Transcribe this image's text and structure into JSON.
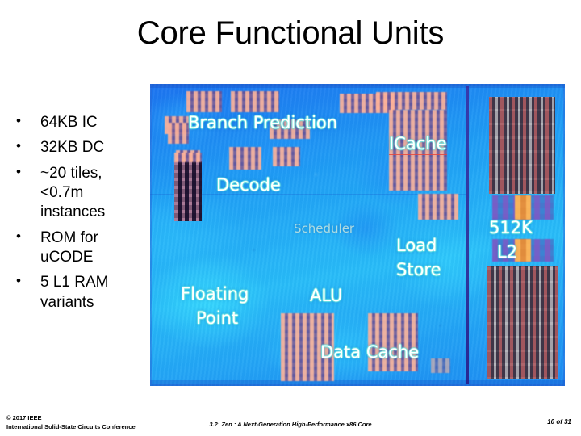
{
  "slide": {
    "title": "Core Functional Units",
    "bullets": [
      "64KB IC",
      "32KB DC",
      "~20 tiles, <0.7m instances",
      "ROM for uCODE",
      "5 L1 RAM variants"
    ]
  },
  "die_photo": {
    "labels": {
      "branch_prediction": "Branch Prediction",
      "decode": "Decode",
      "icache": "ICache",
      "scheduler": "Scheduler",
      "load": "Load",
      "store": "Store",
      "floating": "Floating",
      "point": "Point",
      "alu": "ALU",
      "data_cache": "Data Cache",
      "l2_size": "512K",
      "l2": "L2"
    },
    "colors": {
      "die_base_blue": "#1f9ef5",
      "hot_cyan": "#28bdf8",
      "sram_salmon": "#e8836b",
      "rom_dark": "#3a2a52",
      "l2_array": "#6a5b72",
      "label_white": "#ffffff",
      "icache_underline": "#e6463c"
    }
  },
  "footer": {
    "copyright": "© 2017 IEEE",
    "conference": "International Solid-State Circuits Conference",
    "paper": "3.2: Zen : A Next-Generation High-Performance x86 Core",
    "page": "10 of 31"
  }
}
